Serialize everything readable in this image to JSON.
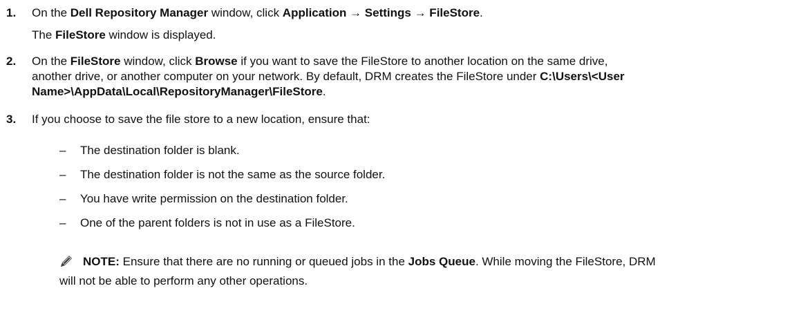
{
  "steps": [
    {
      "num": "1.",
      "l1_a": "On the ",
      "l1_b": "Dell Repository Manager",
      "l1_c": " window, click ",
      "l1_d": "Application → Settings → FileStore",
      "l1_e": ".",
      "r_a": "The ",
      "r_b": "FileStore",
      "r_c": " window is displayed."
    },
    {
      "num": "2.",
      "l1_a": "On the ",
      "l1_b": "FileStore",
      "l1_c": " window, click ",
      "l1_d": "Browse",
      "l1_e": " if you want to save the FileStore to another location on the same drive,",
      "l2_a": "another drive, or another computer on your network. By default, DRM creates the FileStore under ",
      "l2_b": "C:\\Users\\<User",
      "l3_a": "Name>\\AppData\\Local\\RepositoryManager\\FileStore",
      "l3_b": "."
    },
    {
      "num": "3.",
      "l1_a": "If you choose to save the file store to a new location, ensure that:"
    }
  ],
  "bullet_marker": "–",
  "bullets": [
    "The destination folder is blank.",
    "The destination folder is not the same as the source folder.",
    "You have write permission on the destination folder.",
    "One of the parent folders is not in use as a FileStore."
  ],
  "note": {
    "icon": "pencil-note-icon",
    "label": "NOTE:",
    "l1_a": " Ensure that there are no running or queued jobs in the ",
    "l1_b": "Jobs Queue",
    "l1_c": ". While moving the FileStore, DRM",
    "l2": "will not be able to perform any other operations."
  }
}
